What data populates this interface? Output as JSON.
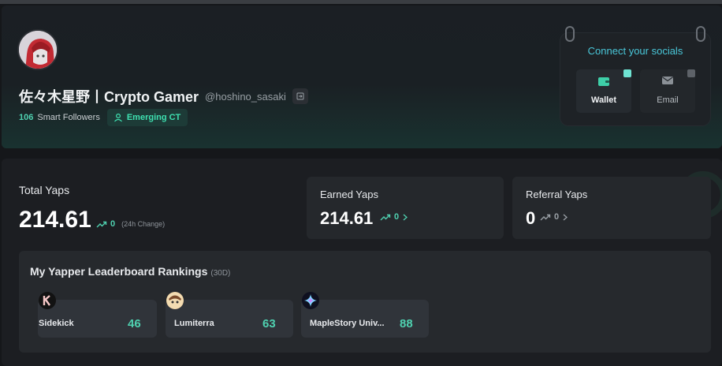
{
  "profile": {
    "name": "佐々木星野丨Crypto Gamer",
    "handle": "@hoshino_sasaki",
    "followers_count": "106",
    "followers_label": "Smart Followers",
    "badge": "Emerging CT"
  },
  "socials": {
    "title": "Connect your socials",
    "buttons": [
      {
        "label": "Wallet",
        "icon": "wallet-icon",
        "status": "connected"
      },
      {
        "label": "Email",
        "icon": "email-icon",
        "status": "not-connected"
      }
    ]
  },
  "stats": {
    "total_label": "Total Yaps",
    "total_value": "214.61",
    "total_change": "0",
    "total_change_label": "(24h Change)",
    "earned_label": "Earned Yaps",
    "earned_value": "214.61",
    "earned_change": "0",
    "referral_label": "Referral Yaps",
    "referral_value": "0",
    "referral_change": "0"
  },
  "leaderboard": {
    "title": "My Yapper Leaderboard Rankings",
    "period": "(30D)",
    "items": [
      {
        "name": "Sidekick",
        "rank": "46",
        "logo": "sidekick-logo"
      },
      {
        "name": "Lumiterra",
        "rank": "63",
        "logo": "lumiterra-logo"
      },
      {
        "name": "MapleStory Univ...",
        "rank": "88",
        "logo": "maplestory-logo"
      }
    ]
  },
  "colors": {
    "accent": "#4fd1b0",
    "background": "#15171a",
    "socials_title": "#49c7d9"
  }
}
